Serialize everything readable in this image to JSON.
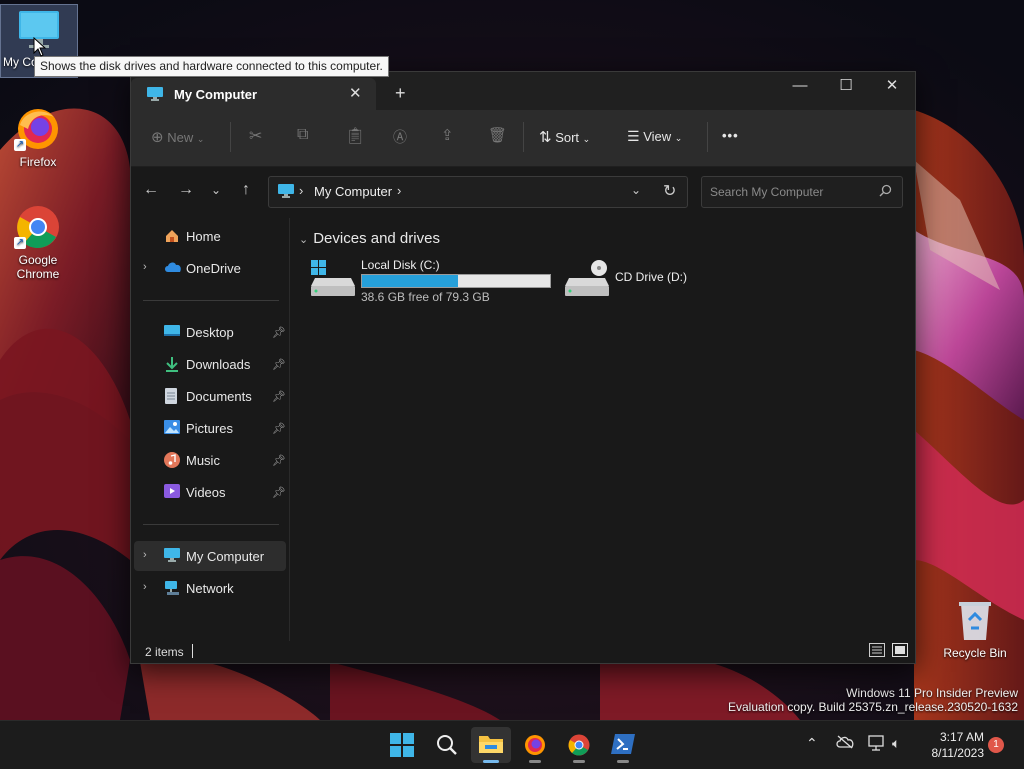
{
  "desktop": {
    "icons": [
      {
        "label": "My Computer",
        "visible_label": "My Co"
      },
      {
        "label": "Firefox"
      },
      {
        "label": "Google\nChrome",
        "line1": "Google",
        "line2": "Chrome"
      },
      {
        "label": "Recycle Bin"
      }
    ],
    "tooltip": "Shows the disk drives and hardware connected to this computer.",
    "watermark": {
      "line1": "Windows 11 Pro Insider Preview",
      "line2": "Evaluation copy. Build 25375.zn_release.230520-1632"
    }
  },
  "window": {
    "tab_title": "My Computer",
    "toolbar": {
      "new_label": "New",
      "sort_label": "Sort",
      "view_label": "View",
      "more_label": "•••"
    },
    "address": {
      "path": "My Computer"
    },
    "search": {
      "placeholder": "Search My Computer"
    },
    "sidebar": {
      "top": [
        "Home",
        "OneDrive"
      ],
      "pinned": [
        "Desktop",
        "Downloads",
        "Documents",
        "Pictures",
        "Music",
        "Videos"
      ],
      "bottom": [
        "My Computer",
        "Network"
      ]
    },
    "content": {
      "group_title": "Devices and drives",
      "drives": [
        {
          "label": "Local Disk (C:)",
          "free_text": "38.6 GB free of 79.3 GB",
          "used_fraction": 0.513
        },
        {
          "label": "CD Drive (D:)"
        }
      ]
    },
    "status": {
      "item_count": "2 items"
    }
  },
  "taskbar": {
    "time": "3:17 AM",
    "date": "8/11/2023",
    "notification_count": "1"
  },
  "colors": {
    "accent": "#26a0da",
    "window_bg": "#191919",
    "toolbar_bg": "#2c2c2c",
    "taskbar_bg": "#1c1c1c"
  }
}
